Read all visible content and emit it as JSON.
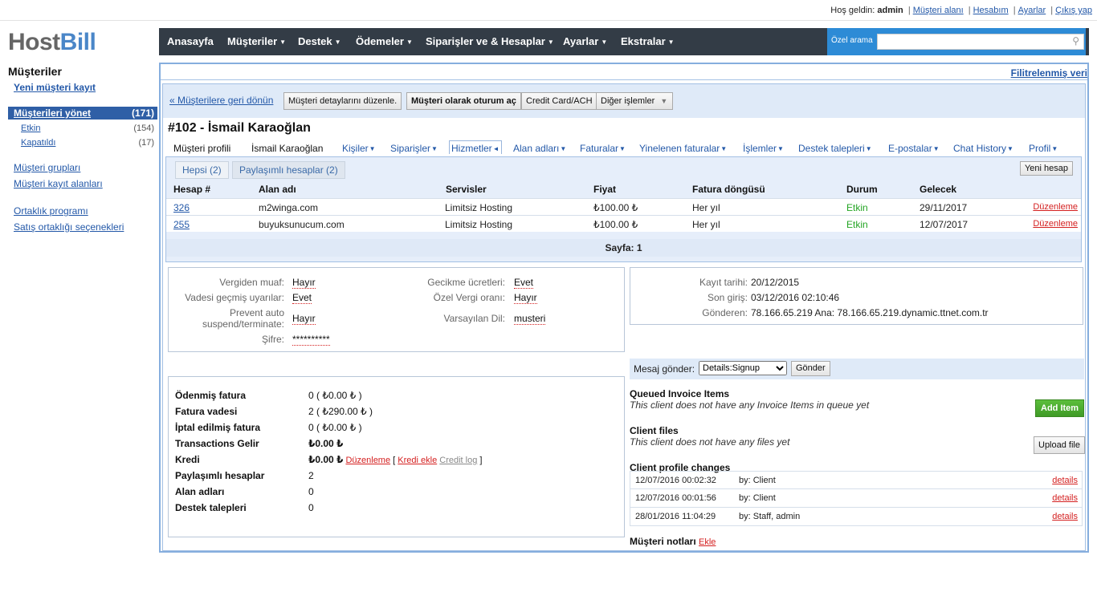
{
  "topbar": {
    "welcome": "Hoş geldin:",
    "user": "admin",
    "links": [
      "Müşteri alanı",
      "Hesabım",
      "Ayarlar",
      "Çıkış yap"
    ]
  },
  "logo": {
    "host": "Host",
    "bill": "Bill"
  },
  "sidebar": {
    "title": "Müşteriler",
    "new_client": "Yeni müşteri kayıt",
    "manage": {
      "label": "Müşterileri yönet",
      "count": "(171)"
    },
    "sub": [
      {
        "label": "Etkin",
        "count": "(154)"
      },
      {
        "label": "Kapatıldı",
        "count": "(17)"
      }
    ],
    "groups": "Müşteri grupları",
    "fields": "Müşteri kayıt alanları",
    "affiliate": "Ortaklık programı",
    "affiliate_opts": "Satış ortaklığı seçenekleri"
  },
  "nav": {
    "items": [
      "Anasayfa",
      "Müşteriler",
      "Destek",
      "Ödemeler",
      "Siparişler ve & Hesaplar",
      "Ayarlar",
      "Ekstralar"
    ],
    "search_label": "Özel arama",
    "search_value": ""
  },
  "filter_link": "Filitrelenmiş veri",
  "actions": {
    "back": "« Müşterilere geri dönün",
    "edit": "Müşteri detaylarını düzenle.",
    "login_as": "Müşteri olarak oturum aç",
    "cc": "Credit Card/ACH",
    "other": "Diğer işlemler"
  },
  "client_title": "#102 - İsmail Karaoğlan",
  "tabs": [
    {
      "label": "Müşteri profili",
      "arrow": ""
    },
    {
      "label": "İsmail Karaoğlan",
      "arrow": ""
    },
    {
      "label": "Kişiler",
      "arrow": "▼"
    },
    {
      "label": "Siparişler",
      "arrow": "▼"
    },
    {
      "label": "Hizmetler",
      "arrow": "◄"
    },
    {
      "label": "Alan adları",
      "arrow": "▼"
    },
    {
      "label": "Faturalar",
      "arrow": "▼"
    },
    {
      "label": "Yinelenen faturalar",
      "arrow": "▼"
    },
    {
      "label": "İşlemler",
      "arrow": "▼"
    },
    {
      "label": "Destek talepleri",
      "arrow": "▼"
    },
    {
      "label": "E-postalar",
      "arrow": "▼"
    },
    {
      "label": "Chat History",
      "arrow": "▼"
    },
    {
      "label": "Profil",
      "arrow": "▼"
    }
  ],
  "services": {
    "subtabs": [
      "Hepsi (2)",
      "Paylaşımlı hesaplar (2)"
    ],
    "new_account": "Yeni hesap",
    "columns": [
      "Hesap #",
      "Alan adı",
      "Servisler",
      "Fiyat",
      "Fatura döngüsü",
      "Durum",
      "Gelecek"
    ],
    "rows": [
      {
        "id": "326",
        "domain": "m2winga.com",
        "service": "Limitsiz Hosting",
        "price": "₺100.00 ₺",
        "cycle": "Her yıl",
        "status": "Etkin",
        "next": "29/11/2017",
        "action": "Düzenleme"
      },
      {
        "id": "255",
        "domain": "buyuksunucum.com",
        "service": "Limitsiz Hosting",
        "price": "₺100.00 ₺",
        "cycle": "Her yıl",
        "status": "Etkin",
        "next": "12/07/2017",
        "action": "Düzenleme"
      }
    ],
    "pager": "Sayfa: 1"
  },
  "settings": {
    "tax_exempt": {
      "label": "Vergiden muaf:",
      "value": "Hayır"
    },
    "overdue": {
      "label": "Vadesi geçmiş uyarılar:",
      "value": "Evet"
    },
    "prevent_line1": "Prevent auto",
    "prevent_line2": "suspend/terminate:",
    "prevent_value": "Hayır",
    "password": {
      "label": "Şifre:",
      "value": "**********"
    },
    "late_fees": {
      "label": "Gecikme ücretleri:",
      "value": "Evet"
    },
    "custom_tax": {
      "label": "Özel Vergi oranı:",
      "value": "Hayır"
    },
    "language": {
      "label": "Varsayılan Dil:",
      "value": "musteri"
    }
  },
  "registration": {
    "date": {
      "label": "Kayıt tarihi:",
      "value": "20/12/2015"
    },
    "last_login": {
      "label": "Son giriş:",
      "value": "03/12/2016 02:10:46"
    },
    "from": {
      "label": "Gönderen:",
      "value": "78.166.65.219 Ana: 78.166.65.219.dynamic.ttnet.com.tr"
    }
  },
  "stats": [
    {
      "label": "Ödenmiş fatura",
      "value": "0 ( ₺0.00 ₺ )"
    },
    {
      "label": "Fatura vadesi",
      "value": "2 ( ₺290.00 ₺ )"
    },
    {
      "label": "İptal edilmiş fatura",
      "value": "0 ( ₺0.00 ₺ )"
    },
    {
      "label": "Transactions Gelir",
      "value": "₺0.00 ₺"
    },
    {
      "label": "Kredi",
      "value": "₺0.00 ₺"
    },
    {
      "label": "Paylaşımlı hesaplar",
      "value": "2"
    },
    {
      "label": "Alan adları",
      "value": "0"
    },
    {
      "label": "Destek talepleri",
      "value": "0"
    }
  ],
  "credit_links": {
    "edit": "Düzenleme",
    "open": "[",
    "add": "Kredi ekle",
    "log": "Credit log",
    "close": "]"
  },
  "message": {
    "label": "Mesaj gönder:",
    "selected": "Details:Signup",
    "send": "Gönder"
  },
  "queued": {
    "title": "Queued Invoice Items",
    "note": "This client does not have any Invoice Items in queue yet",
    "button": "Add Item"
  },
  "files": {
    "title": "Client files",
    "note": "This client does not have any files yet",
    "button": "Upload file"
  },
  "profile_changes": {
    "title": "Client profile changes",
    "rows": [
      {
        "date": "12/07/2016 00:02:32",
        "by": "by: Client",
        "link": "details"
      },
      {
        "date": "12/07/2016 00:01:56",
        "by": "by: Client",
        "link": "details"
      },
      {
        "date": "28/01/2016 11:04:29",
        "by": "by: Staff, admin",
        "link": "details"
      }
    ]
  },
  "notes": {
    "title": "Müşteri notları",
    "add": "Ekle"
  }
}
